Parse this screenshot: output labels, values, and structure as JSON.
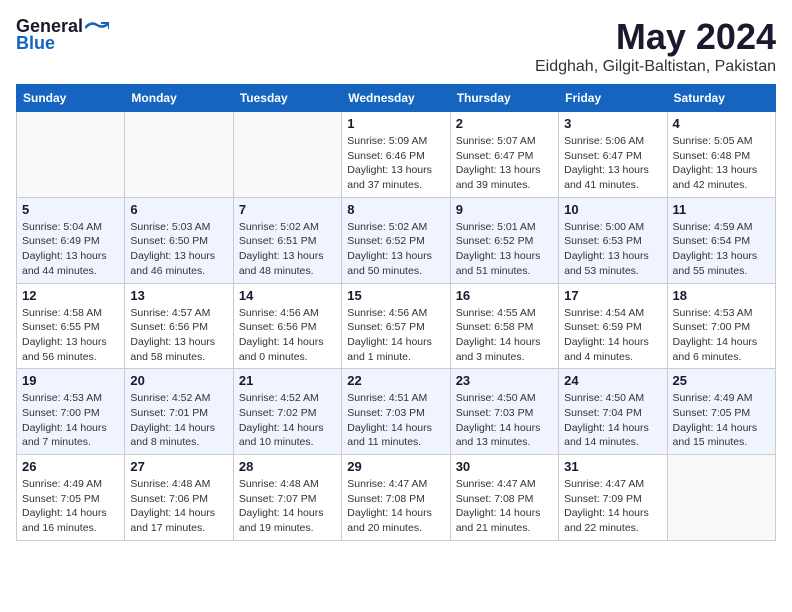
{
  "header": {
    "logo_general": "General",
    "logo_blue": "Blue",
    "month_year": "May 2024",
    "location": "Eidghah, Gilgit-Baltistan, Pakistan"
  },
  "weekdays": [
    "Sunday",
    "Monday",
    "Tuesday",
    "Wednesday",
    "Thursday",
    "Friday",
    "Saturday"
  ],
  "weeks": [
    [
      {
        "day": "",
        "info": ""
      },
      {
        "day": "",
        "info": ""
      },
      {
        "day": "",
        "info": ""
      },
      {
        "day": "1",
        "info": "Sunrise: 5:09 AM\nSunset: 6:46 PM\nDaylight: 13 hours and 37 minutes."
      },
      {
        "day": "2",
        "info": "Sunrise: 5:07 AM\nSunset: 6:47 PM\nDaylight: 13 hours and 39 minutes."
      },
      {
        "day": "3",
        "info": "Sunrise: 5:06 AM\nSunset: 6:47 PM\nDaylight: 13 hours and 41 minutes."
      },
      {
        "day": "4",
        "info": "Sunrise: 5:05 AM\nSunset: 6:48 PM\nDaylight: 13 hours and 42 minutes."
      }
    ],
    [
      {
        "day": "5",
        "info": "Sunrise: 5:04 AM\nSunset: 6:49 PM\nDaylight: 13 hours and 44 minutes."
      },
      {
        "day": "6",
        "info": "Sunrise: 5:03 AM\nSunset: 6:50 PM\nDaylight: 13 hours and 46 minutes."
      },
      {
        "day": "7",
        "info": "Sunrise: 5:02 AM\nSunset: 6:51 PM\nDaylight: 13 hours and 48 minutes."
      },
      {
        "day": "8",
        "info": "Sunrise: 5:02 AM\nSunset: 6:52 PM\nDaylight: 13 hours and 50 minutes."
      },
      {
        "day": "9",
        "info": "Sunrise: 5:01 AM\nSunset: 6:52 PM\nDaylight: 13 hours and 51 minutes."
      },
      {
        "day": "10",
        "info": "Sunrise: 5:00 AM\nSunset: 6:53 PM\nDaylight: 13 hours and 53 minutes."
      },
      {
        "day": "11",
        "info": "Sunrise: 4:59 AM\nSunset: 6:54 PM\nDaylight: 13 hours and 55 minutes."
      }
    ],
    [
      {
        "day": "12",
        "info": "Sunrise: 4:58 AM\nSunset: 6:55 PM\nDaylight: 13 hours and 56 minutes."
      },
      {
        "day": "13",
        "info": "Sunrise: 4:57 AM\nSunset: 6:56 PM\nDaylight: 13 hours and 58 minutes."
      },
      {
        "day": "14",
        "info": "Sunrise: 4:56 AM\nSunset: 6:56 PM\nDaylight: 14 hours and 0 minutes."
      },
      {
        "day": "15",
        "info": "Sunrise: 4:56 AM\nSunset: 6:57 PM\nDaylight: 14 hours and 1 minute."
      },
      {
        "day": "16",
        "info": "Sunrise: 4:55 AM\nSunset: 6:58 PM\nDaylight: 14 hours and 3 minutes."
      },
      {
        "day": "17",
        "info": "Sunrise: 4:54 AM\nSunset: 6:59 PM\nDaylight: 14 hours and 4 minutes."
      },
      {
        "day": "18",
        "info": "Sunrise: 4:53 AM\nSunset: 7:00 PM\nDaylight: 14 hours and 6 minutes."
      }
    ],
    [
      {
        "day": "19",
        "info": "Sunrise: 4:53 AM\nSunset: 7:00 PM\nDaylight: 14 hours and 7 minutes."
      },
      {
        "day": "20",
        "info": "Sunrise: 4:52 AM\nSunset: 7:01 PM\nDaylight: 14 hours and 8 minutes."
      },
      {
        "day": "21",
        "info": "Sunrise: 4:52 AM\nSunset: 7:02 PM\nDaylight: 14 hours and 10 minutes."
      },
      {
        "day": "22",
        "info": "Sunrise: 4:51 AM\nSunset: 7:03 PM\nDaylight: 14 hours and 11 minutes."
      },
      {
        "day": "23",
        "info": "Sunrise: 4:50 AM\nSunset: 7:03 PM\nDaylight: 14 hours and 13 minutes."
      },
      {
        "day": "24",
        "info": "Sunrise: 4:50 AM\nSunset: 7:04 PM\nDaylight: 14 hours and 14 minutes."
      },
      {
        "day": "25",
        "info": "Sunrise: 4:49 AM\nSunset: 7:05 PM\nDaylight: 14 hours and 15 minutes."
      }
    ],
    [
      {
        "day": "26",
        "info": "Sunrise: 4:49 AM\nSunset: 7:05 PM\nDaylight: 14 hours and 16 minutes."
      },
      {
        "day": "27",
        "info": "Sunrise: 4:48 AM\nSunset: 7:06 PM\nDaylight: 14 hours and 17 minutes."
      },
      {
        "day": "28",
        "info": "Sunrise: 4:48 AM\nSunset: 7:07 PM\nDaylight: 14 hours and 19 minutes."
      },
      {
        "day": "29",
        "info": "Sunrise: 4:47 AM\nSunset: 7:08 PM\nDaylight: 14 hours and 20 minutes."
      },
      {
        "day": "30",
        "info": "Sunrise: 4:47 AM\nSunset: 7:08 PM\nDaylight: 14 hours and 21 minutes."
      },
      {
        "day": "31",
        "info": "Sunrise: 4:47 AM\nSunset: 7:09 PM\nDaylight: 14 hours and 22 minutes."
      },
      {
        "day": "",
        "info": ""
      }
    ]
  ]
}
